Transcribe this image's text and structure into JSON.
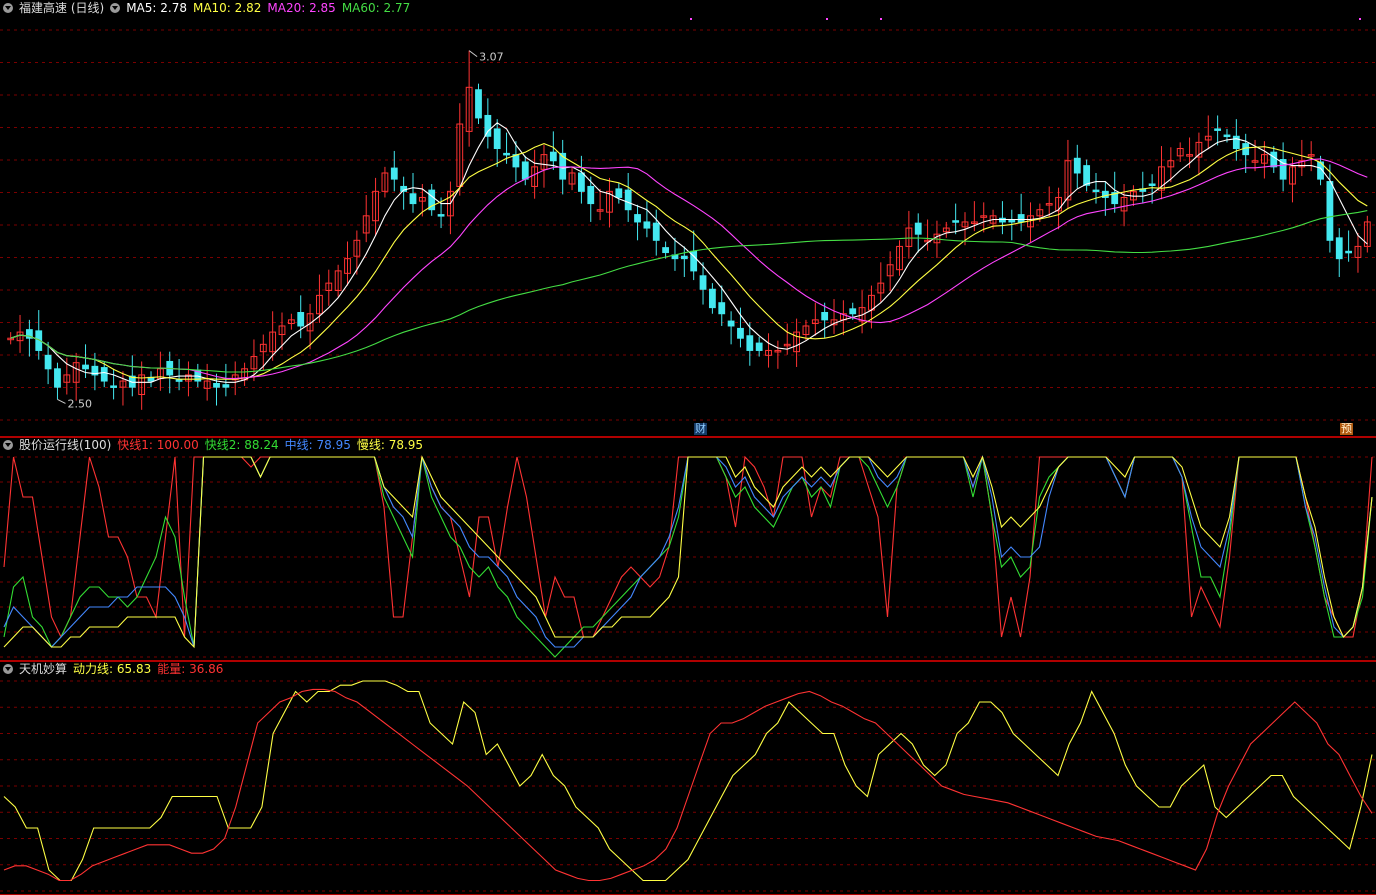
{
  "main": {
    "title": "福建高速 (日线)",
    "ma_labels": [
      {
        "text": "MA5: 2.78",
        "color": "#ffffff"
      },
      {
        "text": "MA10: 2.82",
        "color": "#ffff44"
      },
      {
        "text": "MA20: 2.85",
        "color": "#ff44ff"
      },
      {
        "text": "MA60: 2.77",
        "color": "#44dd44"
      }
    ],
    "high_label": "3.07",
    "low_label": "2.50",
    "marker_cai": "财",
    "marker_yu": "预"
  },
  "ind1": {
    "title": "股价运行线(100)",
    "labels": [
      {
        "text": "快线1: 100.00",
        "color": "#ff3333"
      },
      {
        "text": "快线2: 88.24",
        "color": "#33dd33"
      },
      {
        "text": "中线: 78.95",
        "color": "#4488ff"
      },
      {
        "text": "慢线: 78.95",
        "color": "#ffff44"
      }
    ]
  },
  "ind2": {
    "title": "天机妙算",
    "labels": [
      {
        "text": "动力线: 65.83",
        "color": "#ffff44"
      },
      {
        "text": "能量: 36.86",
        "color": "#ff3333"
      }
    ]
  },
  "colors": {
    "up": "#ff3333",
    "down": "#44e8f0",
    "grid": "#7a0000",
    "border": "#b00000"
  },
  "chart_data": [
    {
      "type": "candlestick",
      "title": "福建高速 (日线)",
      "ylim": [
        2.45,
        3.12
      ],
      "close_series": [
        2.6,
        2.61,
        2.6,
        2.58,
        2.55,
        2.52,
        2.54,
        2.56,
        2.55,
        2.54,
        2.53,
        2.52,
        2.53,
        2.52,
        2.54,
        2.53,
        2.55,
        2.54,
        2.53,
        2.54,
        2.53,
        2.53,
        2.52,
        2.52,
        2.54,
        2.55,
        2.57,
        2.59,
        2.61,
        2.62,
        2.63,
        2.62,
        2.64,
        2.67,
        2.69,
        2.71,
        2.73,
        2.76,
        2.8,
        2.84,
        2.87,
        2.86,
        2.84,
        2.82,
        2.83,
        2.81,
        2.8,
        2.84,
        2.95,
        3.01,
        2.96,
        2.93,
        2.91,
        2.9,
        2.88,
        2.86,
        2.88,
        2.9,
        2.89,
        2.86,
        2.87,
        2.84,
        2.82,
        2.81,
        2.84,
        2.83,
        2.81,
        2.79,
        2.78,
        2.76,
        2.74,
        2.73,
        2.73,
        2.71,
        2.68,
        2.65,
        2.64,
        2.62,
        2.6,
        2.58,
        2.58,
        2.58,
        2.58,
        2.59,
        2.61,
        2.62,
        2.63,
        2.63,
        2.63,
        2.64,
        2.64,
        2.65,
        2.67,
        2.69,
        2.72,
        2.75,
        2.78,
        2.77,
        2.76,
        2.77,
        2.78,
        2.79,
        2.79,
        2.79,
        2.8,
        2.8,
        2.79,
        2.79,
        2.79,
        2.8,
        2.81,
        2.82,
        2.83,
        2.89,
        2.87,
        2.85,
        2.84,
        2.83,
        2.82,
        2.83,
        2.84,
        2.84,
        2.85,
        2.88,
        2.89,
        2.91,
        2.9,
        2.92,
        2.93,
        2.94,
        2.93,
        2.91,
        2.9,
        2.89,
        2.9,
        2.88,
        2.86,
        2.88,
        2.89,
        2.9,
        2.86,
        2.76,
        2.73,
        2.74,
        2.75,
        2.79
      ],
      "high": 3.07,
      "low": 2.5
    },
    {
      "type": "line",
      "title": "股价运行线(100)",
      "ylim": [
        0,
        100
      ],
      "series": [
        {
          "name": "快线1",
          "values": [
            45,
            100,
            80,
            80,
            50,
            20,
            10,
            20,
            60,
            100,
            85,
            60,
            60,
            50,
            30,
            30,
            20,
            60,
            100,
            10,
            100,
            100,
            100,
            100,
            100,
            100,
            95,
            100,
            100,
            100,
            100,
            100,
            100,
            100,
            100,
            100,
            100,
            100,
            100,
            100,
            75,
            20,
            20,
            60,
            100,
            85,
            75,
            70,
            50,
            30,
            70,
            70,
            45,
            75,
            100,
            80,
            50,
            20,
            40,
            30,
            30,
            10,
            10,
            20,
            30,
            40,
            45,
            40,
            35,
            40,
            55,
            100,
            100,
            100,
            100,
            100,
            90,
            65,
            100,
            95,
            85,
            70,
            100,
            100,
            100,
            70,
            85,
            80,
            100,
            100,
            100,
            85,
            70,
            20,
            85,
            100,
            100,
            100,
            100,
            100,
            100,
            100,
            85,
            100,
            70,
            10,
            30,
            10,
            40,
            100,
            100,
            100,
            100,
            100,
            100,
            100,
            100,
            90,
            80,
            100,
            100,
            100,
            100,
            100,
            90,
            20,
            35,
            25,
            15,
            50,
            100,
            100,
            100,
            100,
            100,
            100,
            100,
            80,
            55,
            30,
            20,
            10,
            10,
            35,
            100
          ]
        },
        {
          "name": "快线2",
          "values": [
            10,
            35,
            40,
            20,
            15,
            5,
            10,
            20,
            30,
            35,
            35,
            30,
            30,
            25,
            30,
            40,
            50,
            70,
            60,
            30,
            5,
            100,
            100,
            100,
            100,
            100,
            100,
            90,
            100,
            100,
            100,
            100,
            100,
            100,
            100,
            100,
            100,
            100,
            100,
            100,
            80,
            70,
            60,
            50,
            100,
            80,
            70,
            60,
            55,
            45,
            40,
            45,
            35,
            30,
            20,
            15,
            10,
            5,
            0,
            5,
            10,
            15,
            15,
            20,
            25,
            30,
            35,
            40,
            45,
            50,
            55,
            70,
            100,
            100,
            100,
            100,
            90,
            80,
            85,
            75,
            70,
            65,
            75,
            85,
            90,
            80,
            85,
            75,
            95,
            100,
            100,
            95,
            85,
            75,
            85,
            100,
            100,
            100,
            100,
            100,
            100,
            100,
            80,
            100,
            70,
            45,
            50,
            40,
            45,
            80,
            90,
            95,
            100,
            100,
            100,
            100,
            100,
            90,
            80,
            100,
            100,
            100,
            100,
            100,
            90,
            65,
            40,
            40,
            30,
            60,
            100,
            100,
            100,
            100,
            100,
            100,
            100,
            75,
            55,
            30,
            10,
            10,
            15,
            30,
            80
          ]
        },
        {
          "name": "中线",
          "values": [
            15,
            25,
            20,
            15,
            10,
            5,
            10,
            15,
            20,
            25,
            25,
            25,
            30,
            30,
            35,
            35,
            35,
            35,
            30,
            20,
            5,
            100,
            100,
            100,
            100,
            100,
            100,
            90,
            100,
            100,
            100,
            100,
            100,
            100,
            100,
            100,
            100,
            100,
            100,
            100,
            85,
            75,
            70,
            60,
            100,
            85,
            75,
            70,
            65,
            55,
            50,
            50,
            45,
            40,
            30,
            25,
            20,
            10,
            5,
            5,
            5,
            10,
            10,
            15,
            20,
            25,
            30,
            40,
            45,
            50,
            60,
            75,
            100,
            100,
            100,
            100,
            95,
            85,
            90,
            80,
            75,
            70,
            80,
            85,
            90,
            85,
            90,
            85,
            95,
            100,
            100,
            100,
            90,
            85,
            90,
            100,
            100,
            100,
            100,
            100,
            100,
            100,
            85,
            100,
            80,
            50,
            55,
            50,
            50,
            55,
            80,
            95,
            100,
            100,
            100,
            100,
            100,
            90,
            80,
            100,
            100,
            100,
            100,
            100,
            90,
            70,
            55,
            50,
            45,
            65,
            100,
            100,
            100,
            100,
            100,
            100,
            100,
            75,
            60,
            35,
            15,
            10,
            15,
            35,
            80
          ]
        },
        {
          "name": "慢线",
          "values": [
            5,
            10,
            15,
            15,
            10,
            5,
            5,
            10,
            10,
            15,
            15,
            15,
            15,
            20,
            20,
            20,
            20,
            20,
            20,
            10,
            5,
            100,
            100,
            100,
            100,
            100,
            100,
            90,
            100,
            100,
            100,
            100,
            100,
            100,
            100,
            100,
            100,
            100,
            100,
            100,
            85,
            80,
            75,
            70,
            100,
            90,
            80,
            75,
            70,
            65,
            60,
            55,
            50,
            45,
            40,
            35,
            30,
            20,
            10,
            10,
            10,
            10,
            10,
            15,
            15,
            20,
            20,
            20,
            20,
            25,
            30,
            40,
            100,
            100,
            100,
            100,
            100,
            90,
            95,
            85,
            80,
            75,
            85,
            90,
            95,
            90,
            95,
            90,
            95,
            100,
            100,
            100,
            95,
            90,
            95,
            100,
            100,
            100,
            100,
            100,
            100,
            100,
            90,
            100,
            85,
            65,
            70,
            65,
            70,
            75,
            85,
            95,
            100,
            100,
            100,
            100,
            100,
            95,
            90,
            100,
            100,
            100,
            100,
            100,
            95,
            80,
            65,
            60,
            55,
            70,
            100,
            100,
            100,
            100,
            100,
            100,
            100,
            80,
            65,
            40,
            20,
            10,
            15,
            35,
            80
          ]
        }
      ]
    },
    {
      "type": "line",
      "title": "天机妙算",
      "ylim": [
        0,
        100
      ],
      "series": [
        {
          "name": "动力线",
          "values": [
            45,
            40,
            30,
            30,
            10,
            5,
            5,
            15,
            30,
            30,
            30,
            30,
            30,
            30,
            35,
            45,
            45,
            45,
            45,
            45,
            30,
            30,
            30,
            40,
            75,
            85,
            95,
            90,
            95,
            95,
            98,
            98,
            100,
            100,
            100,
            98,
            95,
            95,
            80,
            75,
            70,
            90,
            85,
            65,
            70,
            60,
            50,
            55,
            65,
            55,
            50,
            40,
            35,
            30,
            20,
            15,
            10,
            5,
            5,
            5,
            10,
            15,
            25,
            35,
            45,
            55,
            60,
            65,
            75,
            80,
            90,
            85,
            80,
            75,
            75,
            60,
            50,
            45,
            65,
            70,
            75,
            70,
            60,
            55,
            60,
            75,
            80,
            90,
            90,
            85,
            75,
            70,
            65,
            60,
            55,
            70,
            80,
            95,
            85,
            75,
            60,
            50,
            45,
            40,
            40,
            50,
            55,
            60,
            40,
            35,
            40,
            45,
            50,
            55,
            55,
            45,
            40,
            35,
            30,
            25,
            20,
            40,
            65
          ]
        },
        {
          "name": "能量",
          "values": [
            10,
            12,
            12,
            10,
            8,
            5,
            5,
            8,
            12,
            14,
            16,
            18,
            20,
            22,
            22,
            22,
            20,
            18,
            18,
            20,
            25,
            40,
            60,
            80,
            85,
            90,
            92,
            95,
            96,
            96,
            95,
            92,
            90,
            86,
            82,
            78,
            74,
            70,
            66,
            62,
            58,
            54,
            50,
            45,
            40,
            35,
            30,
            25,
            20,
            15,
            10,
            8,
            6,
            5,
            5,
            6,
            8,
            10,
            12,
            15,
            20,
            30,
            45,
            60,
            75,
            80,
            80,
            82,
            85,
            88,
            90,
            92,
            94,
            95,
            93,
            90,
            88,
            85,
            82,
            80,
            75,
            70,
            65,
            60,
            55,
            50,
            48,
            46,
            45,
            44,
            43,
            42,
            40,
            38,
            36,
            34,
            32,
            30,
            28,
            26,
            25,
            24,
            22,
            20,
            18,
            16,
            14,
            12,
            10,
            20,
            37,
            50,
            60,
            70,
            75,
            80,
            85,
            90,
            85,
            80,
            70,
            65,
            55,
            45,
            37
          ]
        }
      ]
    }
  ]
}
